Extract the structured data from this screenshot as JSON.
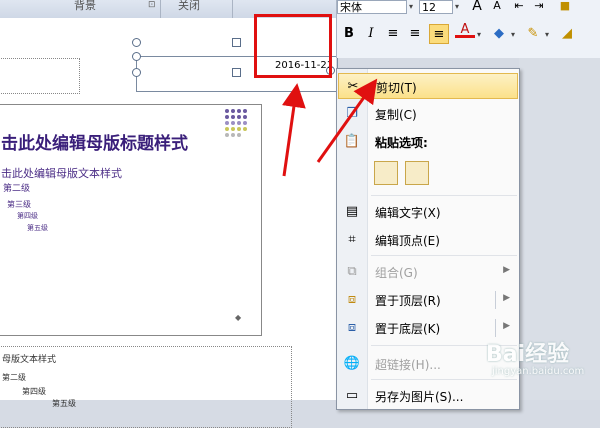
{
  "ribbon": {
    "group_background": "背景",
    "group_close": "关闭"
  },
  "slide": {
    "date": "2016-11-21",
    "title": "击此处编辑母版标题样式",
    "body_level1": "击此处编辑母版文本样式",
    "body_level2": "第二级",
    "body_level3": "第三级",
    "body_level4": "第四级",
    "body_level5": "第五级"
  },
  "lower_placeholder": {
    "line1": "母版文本样式",
    "line2": "第二级",
    "line3": "第四级",
    "line4": "第五级"
  },
  "mini_toolbar": {
    "font_name": "宋体",
    "font_size": "12",
    "bold": "B",
    "italic": "I",
    "font_color_label": "A"
  },
  "context_menu": {
    "items": [
      {
        "label": "剪切(T)",
        "icon": "scissors-icon"
      },
      {
        "label": "复制(C)",
        "icon": "copy-icon"
      },
      {
        "label": "粘贴选项:",
        "icon": "paste-icon"
      },
      {
        "label": "编辑文字(X)",
        "icon": "text-box-icon"
      },
      {
        "label": "编辑顶点(E)",
        "icon": "edit-points-icon"
      },
      {
        "label": "组合(G)",
        "icon": "group-icon"
      },
      {
        "label": "置于顶层(R)",
        "icon": "bring-front-icon"
      },
      {
        "label": "置于底层(K)",
        "icon": "send-back-icon"
      },
      {
        "label": "超链接(H)...",
        "icon": "hyperlink-icon"
      },
      {
        "label": "另存为图片(S)...",
        "icon": "save-picture-icon"
      }
    ]
  },
  "watermark": {
    "brand": "Bai经验",
    "url": "jingyan.baidu.com"
  },
  "colors": {
    "highlight": "#e01010",
    "menu_hover": "#fbe18a",
    "title": "#3a1f7a"
  }
}
